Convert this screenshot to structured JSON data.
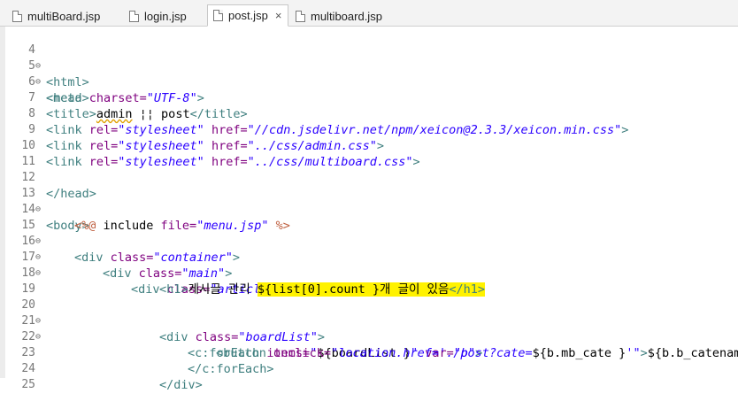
{
  "tabs": [
    {
      "label": "multiBoard.jsp",
      "active": false
    },
    {
      "label": "login.jsp",
      "active": false
    },
    {
      "label": "post.jsp",
      "active": true,
      "close": "×"
    },
    {
      "label": "multiboard.jsp",
      "active": false
    }
  ],
  "lines": [
    {
      "num": "4",
      "fold": "⊖"
    },
    {
      "num": "5",
      "fold": "⊖"
    },
    {
      "num": "6"
    },
    {
      "num": "7"
    },
    {
      "num": "8"
    },
    {
      "num": "9"
    },
    {
      "num": "10"
    },
    {
      "num": "11"
    },
    {
      "num": "12"
    },
    {
      "num": "13",
      "fold": "⊖"
    },
    {
      "num": "14"
    },
    {
      "num": "15",
      "fold": "⊖"
    },
    {
      "num": "16",
      "fold": "⊖"
    },
    {
      "num": "17",
      "fold": "⊖"
    },
    {
      "num": "18"
    },
    {
      "num": "19"
    },
    {
      "num": "20",
      "fold": "⊖"
    },
    {
      "num": "21",
      "fold": "⊖"
    },
    {
      "num": "22"
    },
    {
      "num": "23"
    },
    {
      "num": "24"
    },
    {
      "num": "25"
    }
  ],
  "code": {
    "l4": "<html>",
    "l5": "<head>",
    "l6_tag": "<meta",
    "l6_attr": " charset=",
    "l6_val": "\"UTF-8\"",
    "l6_end": ">",
    "l7_open": "<title>",
    "l7_text1": "admin",
    "l7_text2": " ¦¦ post",
    "l7_close": "</title>",
    "l8_tag": "<link",
    "l8_attr1": " rel=",
    "l8_val1": "\"stylesheet\"",
    "l8_attr2": " href=",
    "l8_val2": "\"//cdn.jsdelivr.net/npm/xeicon@2.3.3/xeicon.min.css\"",
    "l8_end": ">",
    "l9_tag": "<link",
    "l9_attr1": " rel=",
    "l9_val1": "\"stylesheet\"",
    "l9_attr2": " href=",
    "l9_val2": "\"../css/admin.css\"",
    "l9_end": ">",
    "l10_tag": "<link",
    "l10_attr1": " rel=",
    "l10_val1": "\"stylesheet\"",
    "l10_attr2": " href=",
    "l10_val2": "\"../css/multiboard.css\"",
    "l10_end": ">",
    "l12": "</head>",
    "l13": "<body>",
    "l14_open": "<%@",
    "l14_kw": " include",
    "l14_attr": " file=",
    "l14_val": "\"menu.jsp\"",
    "l14_end": " %>",
    "l15_tag": "<div",
    "l15_attr": " class=",
    "l15_val": "\"container\"",
    "l15_end": ">",
    "l16_tag": "<div",
    "l16_attr": " class=",
    "l16_val": "\"main\"",
    "l16_end": ">",
    "l17_tag": "<div",
    "l17_attr": " class=",
    "l17_val": "\"article\"",
    "l17_end": ">",
    "l18_open": "<h1>",
    "l18_text1": "게시글 관리 ",
    "l18_text2": "${list[0].count }개 글이 있음",
    "l18_close": "</h1>",
    "l20_tag": "<div",
    "l20_attr": " class=",
    "l20_val": "\"boardList\"",
    "l20_end": ">",
    "l21_tag": "<c:forEach",
    "l21_attr1": " items=",
    "l21_val1a": "\"",
    "l21_val1b": "${boardList }",
    "l21_val1c": "\"",
    "l21_attr2": " var=",
    "l21_val2": "\"b\"",
    "l21_end": ">",
    "l22_tag": "<button",
    "l22_attr": " onclick=",
    "l22_val1": "\"location.href='./post?cate=",
    "l22_val2": "${b.mb_cate }",
    "l22_val3": "'\"",
    "l22_end": ">",
    "l22_rest": "${b.b_catename",
    "l23": "</c:forEach>",
    "l24": "</div>"
  }
}
